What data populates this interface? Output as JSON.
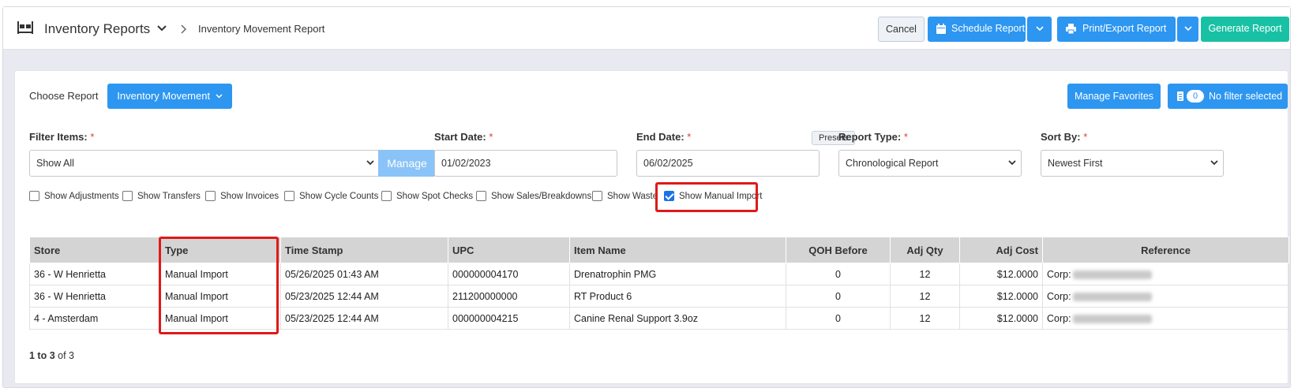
{
  "header": {
    "title": "Inventory Reports",
    "breadcrumb": "Inventory Movement Report",
    "buttons": {
      "cancel": "Cancel",
      "schedule": "Schedule Report",
      "print": "Print/Export Report",
      "generate": "Generate Report"
    }
  },
  "report": {
    "choose_label": "Choose Report",
    "selected": "Inventory Movement",
    "manage_favorites": "Manage Favorites",
    "filter_count": "0",
    "filter_text": "No filter selected"
  },
  "filters": {
    "filter_items_label": "Filter Items:",
    "filter_items_value": "Show All",
    "manage": "Manage",
    "start_label": "Start Date:",
    "start_value": "01/02/2023",
    "end_label": "End Date:",
    "end_value": "06/02/2025",
    "presets": "Presets",
    "report_type_label": "Report Type:",
    "report_type_value": "Chronological Report",
    "sort_label": "Sort By:",
    "sort_value": "Newest First",
    "required_mark": "*"
  },
  "checkboxes": [
    {
      "label": "Show Adjustments",
      "checked": false
    },
    {
      "label": "Show Transfers",
      "checked": false
    },
    {
      "label": "Show Invoices",
      "checked": false
    },
    {
      "label": "Show Cycle Counts",
      "checked": false
    },
    {
      "label": "Show Spot Checks",
      "checked": false
    },
    {
      "label": "Show Sales/Breakdowns",
      "checked": false
    },
    {
      "label": "Show Waste",
      "checked": false
    },
    {
      "label": "Show Manual Import",
      "checked": true
    }
  ],
  "table": {
    "columns": [
      "Store",
      "Type",
      "Time Stamp",
      "UPC",
      "Item Name",
      "QOH Before",
      "Adj Qty",
      "Adj Cost",
      "Reference"
    ],
    "rows": [
      {
        "store": "36 - W Henrietta",
        "type": "Manual Import",
        "time": "05/26/2025 01:43 AM",
        "upc": "000000004170",
        "item": "Drenatrophin PMG",
        "qoh": "0",
        "qty": "12",
        "cost": "$12.0000",
        "ref": "Corp:"
      },
      {
        "store": "36 - W Henrietta",
        "type": "Manual Import",
        "time": "05/23/2025 12:44 AM",
        "upc": "211200000000",
        "item": "RT Product 6",
        "qoh": "0",
        "qty": "12",
        "cost": "$12.0000",
        "ref": "Corp:"
      },
      {
        "store": "4 - Amsterdam",
        "type": "Manual Import",
        "time": "05/23/2025 12:44 AM",
        "upc": "000000004215",
        "item": "Canine Renal Support 3.9oz",
        "qoh": "0",
        "qty": "12",
        "cost": "$12.0000",
        "ref": "Corp:"
      }
    ]
  },
  "pager": {
    "range": "1 to 3",
    "total": "of 3"
  },
  "colors": {
    "primary": "#2d96f1",
    "teal": "#19c1a4",
    "highlight": "#e01919"
  }
}
